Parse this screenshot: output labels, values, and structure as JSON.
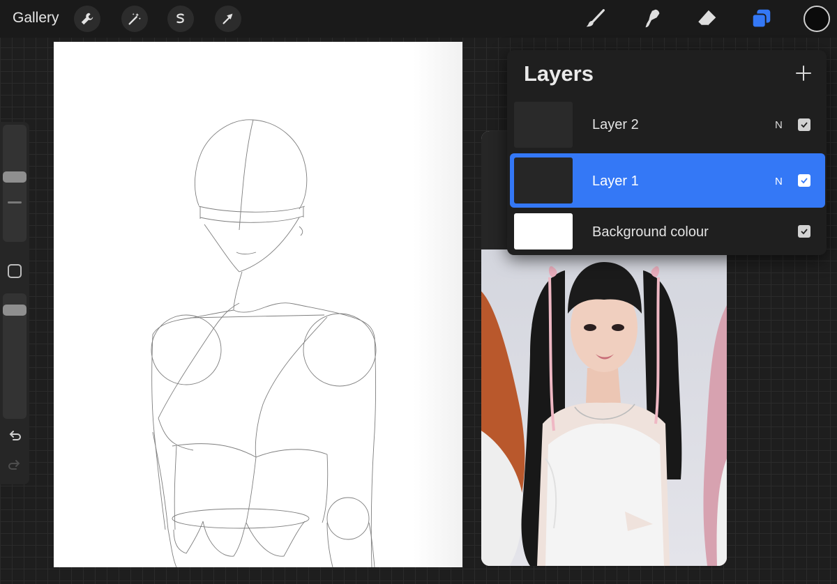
{
  "topbar": {
    "gallery_label": "Gallery",
    "left_tools": [
      {
        "icon": "wrench-icon",
        "name": "actions"
      },
      {
        "icon": "magic-wand-icon",
        "name": "adjustments"
      },
      {
        "icon": "selection-icon",
        "name": "selection"
      },
      {
        "icon": "arrow-cursor-icon",
        "name": "transform"
      }
    ],
    "right_tools": [
      {
        "icon": "brush-icon",
        "name": "paint"
      },
      {
        "icon": "smudge-icon",
        "name": "smudge"
      },
      {
        "icon": "eraser-icon",
        "name": "erase"
      },
      {
        "icon": "layers-icon",
        "name": "layers"
      }
    ],
    "active_tool_color": "#3478f6",
    "current_color": "#0b0b0b"
  },
  "sidebar": {
    "brush_size_level": 0.56,
    "opacity_level": 0.9,
    "icons": [
      "modify-square-icon",
      "undo-icon",
      "redo-icon"
    ]
  },
  "layers_panel": {
    "title": "Layers",
    "layers": [
      {
        "name": "Layer 2",
        "mode": "N",
        "visible": true,
        "selected": false
      },
      {
        "name": "Layer 1",
        "mode": "N",
        "visible": true,
        "selected": true
      },
      {
        "name": "Background colour",
        "mode": "",
        "visible": true,
        "selected": false
      }
    ]
  },
  "colors": {
    "accent": "#3478f6",
    "panel": "#1f1f1f",
    "canvas": "#ffffff"
  }
}
